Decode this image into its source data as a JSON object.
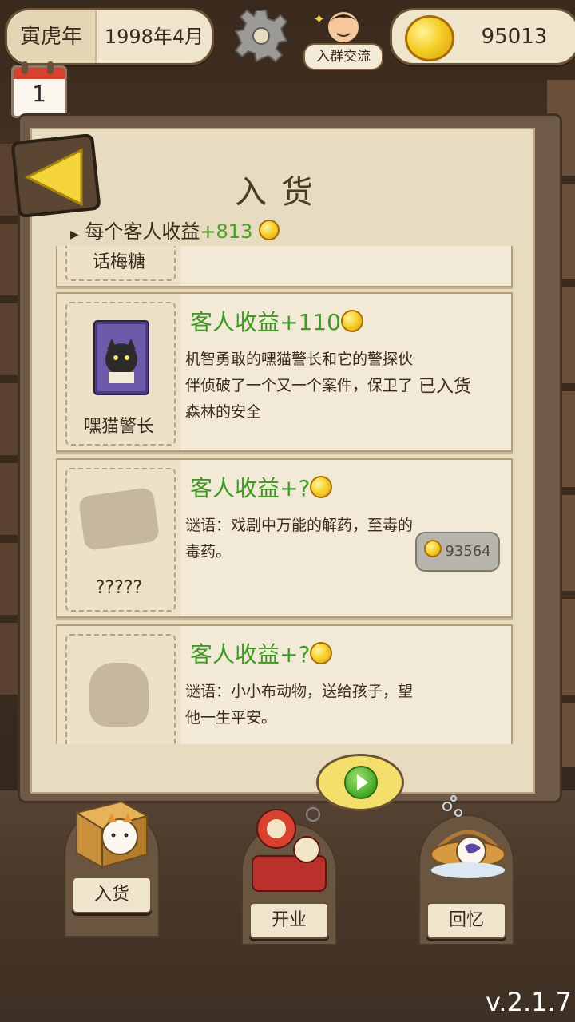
{
  "header": {
    "era_year": "寅虎年",
    "era_date": "1998年4月",
    "calendar_day": "1",
    "group_label": "入群交流",
    "coins": "95013"
  },
  "panel": {
    "title": "入货",
    "income_prefix": "每个客人收益",
    "income_value": "+813"
  },
  "items": [
    {
      "name": "话梅糖",
      "title": "",
      "desc": "",
      "status": "",
      "price": ""
    },
    {
      "name": "嘿猫警长",
      "title": "客人收益+110",
      "desc": "机智勇敢的嘿猫警长和它的警探伙伴侦破了一个又一个案件，保卫了森林的安全",
      "status": "已入货",
      "price": ""
    },
    {
      "name": "?????",
      "title": "客人收益+?",
      "desc": "谜语：戏剧中万能的解药，至毒的毒药。",
      "status": "",
      "price": "93564"
    },
    {
      "name": "",
      "title": "客人收益+?",
      "desc": "谜语：小小布动物，送给孩子，望他一生平安。",
      "status": "",
      "price": ""
    }
  ],
  "dock": {
    "stock_label": "入货",
    "open_label": "开业",
    "memory_label": "回忆"
  },
  "version": "v.2.1.7",
  "colors": {
    "accent_green": "#3d9a22",
    "parchment": "#e7dcbf",
    "coin": "#f6cf28"
  }
}
